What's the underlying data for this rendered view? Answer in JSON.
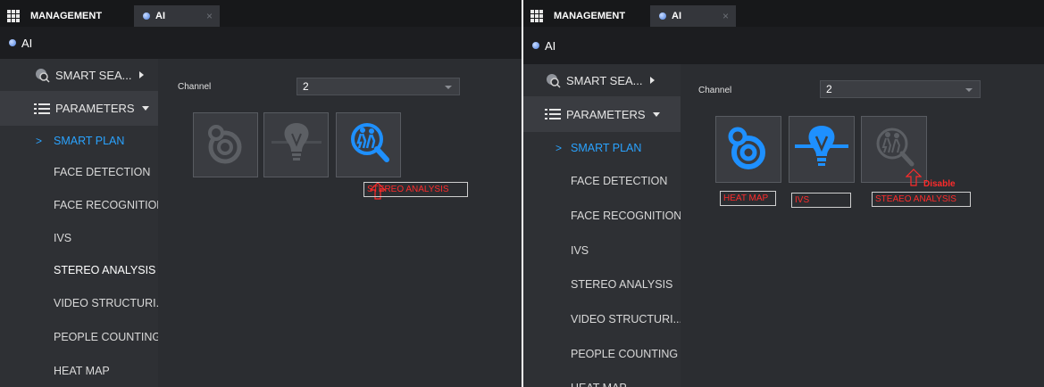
{
  "tabs": {
    "management": "MANAGEMENT",
    "ai": "AI",
    "close": "×"
  },
  "header": {
    "title": "AI"
  },
  "sidebar": {
    "smart_search": "SMART SEA...",
    "parameters": "PARAMETERS",
    "items": [
      "SMART PLAN",
      "FACE DETECTION",
      "FACE RECOGNITION",
      "IVS",
      "STEREO ANALYSIS",
      "VIDEO STRUCTURI...",
      "PEOPLE COUNTING",
      "HEAT MAP"
    ]
  },
  "form": {
    "channel_label": "Channel",
    "channel_value": "2"
  },
  "annotations_left": {
    "stereo": "STEREO ANALYSIS"
  },
  "annotations_right": {
    "heat_map": "HEAT MAP",
    "ivs": "IVS",
    "stereo": "STEAEO ANALYSIS",
    "disable": "Disable"
  },
  "colors": {
    "accent": "#2aa3ff",
    "annotation": "#ff2b2b",
    "panel_bg": "#2b2d31",
    "sidebar_bg": "#2e3034"
  },
  "icons": {
    "heat_map": "heat-map-icon",
    "ivs": "bulb-icon",
    "stereo": "people-magnifier-icon"
  }
}
